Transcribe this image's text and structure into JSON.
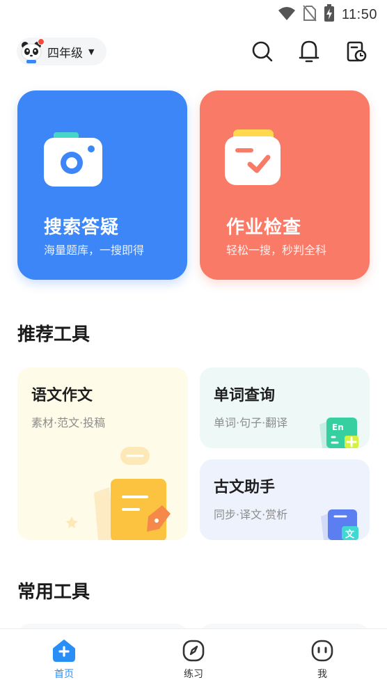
{
  "status_bar": {
    "time": "11:50",
    "icons": [
      "wifi-icon",
      "no-sim-icon",
      "battery-charging-icon"
    ]
  },
  "header": {
    "grade": "四年级",
    "avatar": "panda-avatar",
    "has_notification_dot": true,
    "icons": [
      "search-icon",
      "bell-icon",
      "history-icon"
    ]
  },
  "hero": {
    "search": {
      "title": "搜索答疑",
      "subtitle": "海量题库，一搜即得",
      "color": "#3d86f7",
      "icon": "camera-icon"
    },
    "homework": {
      "title": "作业检查",
      "subtitle": "轻松一搜，秒判全科",
      "color": "#fa7a68",
      "icon": "check-card-icon"
    }
  },
  "sections": {
    "recommended": "推荐工具",
    "common": "常用工具"
  },
  "tools": [
    {
      "title": "语文作文",
      "subtitle": "素材·范文·投稿",
      "color": "#fffbe9",
      "icon": "essay-pen-icon"
    },
    {
      "title": "单词查询",
      "subtitle": "单词·句子·翻译",
      "color": "#eef8f7",
      "icon": "english-book-icon"
    },
    {
      "title": "古文助手",
      "subtitle": "同步·译文·赏析",
      "color": "#eef2fc",
      "icon": "classic-book-icon"
    }
  ],
  "bottom_nav": [
    {
      "label": "首页",
      "icon": "home-icon",
      "active": true,
      "color": "#2a8ef7"
    },
    {
      "label": "练习",
      "icon": "compass-icon",
      "active": false
    },
    {
      "label": "我",
      "icon": "face-icon",
      "active": false
    }
  ]
}
